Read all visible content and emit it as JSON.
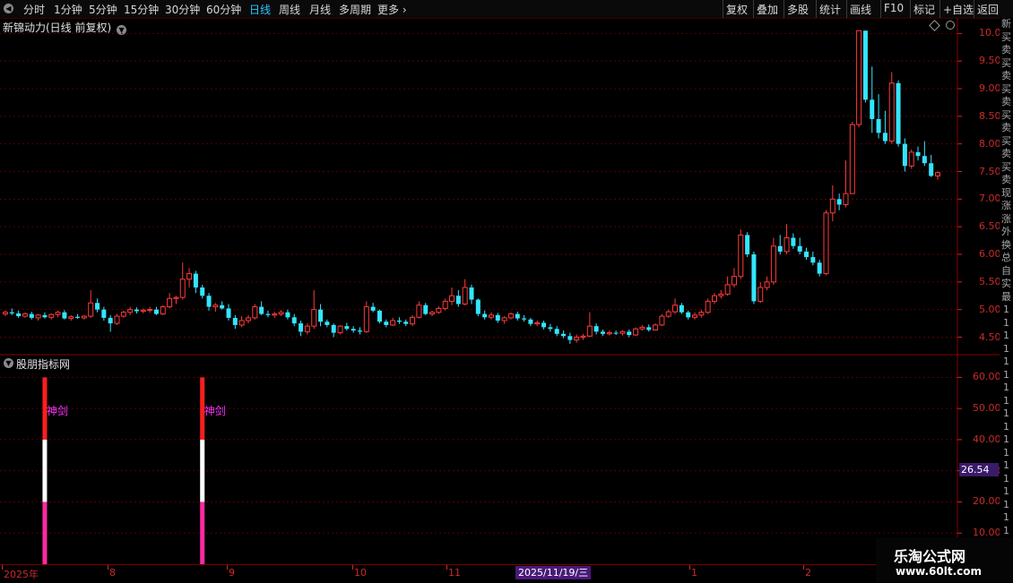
{
  "toolbar": {
    "left": [
      "分时",
      "1分钟",
      "5分钟",
      "15分钟",
      "30分钟",
      "60分钟",
      "日线",
      "周线",
      "月线",
      "多周期",
      "更多"
    ],
    "active": "日线",
    "more_arrow": "›",
    "right": [
      "复权",
      "叠加",
      "多股",
      "统计",
      "画线",
      "F10",
      "标记",
      "+自选",
      "返回"
    ]
  },
  "chart": {
    "title": "新锦动力(日线 前复权)",
    "y_ticks": [
      "10.00",
      "9.50",
      "9.00",
      "8.50",
      "8.00",
      "7.50",
      "7.00",
      "6.50",
      "6.00",
      "5.50",
      "5.00",
      "4.50"
    ]
  },
  "indicator": {
    "title": "股朋指标网",
    "y_ticks": [
      "60.00",
      "50.00",
      "40.00",
      "30.00",
      "20.00",
      "10.00"
    ],
    "current_value": "26.54",
    "signal_label": "神剑"
  },
  "date_axis": {
    "labels": [
      "2025年",
      "8",
      "9",
      "10",
      "11",
      "1",
      "2"
    ],
    "highlight": "2025/11/19/三"
  },
  "watermark": {
    "line1": "乐淘公式网",
    "line2": "www.60lt.com"
  },
  "right_strip": [
    "新",
    "买",
    "卖",
    "买",
    "卖",
    "买",
    "卖",
    "买",
    "卖",
    "买",
    "卖",
    "买",
    "卖",
    "现",
    "涨",
    "涨",
    "外",
    "换",
    "总",
    "自",
    "实",
    "最",
    "1",
    "1",
    "1",
    "1",
    "1",
    "1",
    "1",
    "1",
    "1",
    "1",
    "1",
    "1",
    "1",
    "1",
    "1",
    "1",
    "1",
    "1",
    "1",
    "1",
    "1"
  ],
  "colors": {
    "up": "#ff3a3a",
    "down": "#33e5ff",
    "grid": "#5a0000",
    "signal_red": "#ff1e1e",
    "signal_white": "#ffffff",
    "signal_pink": "#ff2aa0",
    "label": "#ff33ff"
  },
  "chart_data": {
    "type": "candlestick",
    "series": [
      {
        "o": 4.92,
        "h": 4.98,
        "l": 4.88,
        "c": 4.95
      },
      {
        "o": 4.95,
        "h": 5.02,
        "l": 4.9,
        "c": 4.93
      },
      {
        "o": 4.93,
        "h": 4.98,
        "l": 4.85,
        "c": 4.88
      },
      {
        "o": 4.88,
        "h": 4.95,
        "l": 4.85,
        "c": 4.92
      },
      {
        "o": 4.92,
        "h": 4.96,
        "l": 4.82,
        "c": 4.85
      },
      {
        "o": 4.85,
        "h": 4.92,
        "l": 4.8,
        "c": 4.9
      },
      {
        "o": 4.9,
        "h": 4.95,
        "l": 4.84,
        "c": 4.86
      },
      {
        "o": 4.86,
        "h": 4.93,
        "l": 4.82,
        "c": 4.91
      },
      {
        "o": 4.91,
        "h": 4.98,
        "l": 4.86,
        "c": 4.95
      },
      {
        "o": 4.95,
        "h": 4.99,
        "l": 4.82,
        "c": 4.84
      },
      {
        "o": 4.84,
        "h": 4.9,
        "l": 4.8,
        "c": 4.87
      },
      {
        "o": 4.87,
        "h": 4.92,
        "l": 4.83,
        "c": 4.85
      },
      {
        "o": 4.85,
        "h": 4.9,
        "l": 4.82,
        "c": 4.88
      },
      {
        "o": 4.88,
        "h": 5.35,
        "l": 4.85,
        "c": 5.12
      },
      {
        "o": 5.12,
        "h": 5.2,
        "l": 4.95,
        "c": 5.0
      },
      {
        "o": 5.0,
        "h": 5.05,
        "l": 4.8,
        "c": 4.85
      },
      {
        "o": 4.85,
        "h": 4.9,
        "l": 4.6,
        "c": 4.75
      },
      {
        "o": 4.75,
        "h": 4.92,
        "l": 4.72,
        "c": 4.88
      },
      {
        "o": 4.88,
        "h": 4.98,
        "l": 4.85,
        "c": 4.95
      },
      {
        "o": 4.95,
        "h": 5.05,
        "l": 4.9,
        "c": 5.0
      },
      {
        "o": 5.0,
        "h": 5.04,
        "l": 4.93,
        "c": 4.97
      },
      {
        "o": 4.97,
        "h": 5.02,
        "l": 4.93,
        "c": 4.99
      },
      {
        "o": 4.99,
        "h": 5.05,
        "l": 4.94,
        "c": 5.0
      },
      {
        "o": 5.0,
        "h": 5.05,
        "l": 4.9,
        "c": 4.92
      },
      {
        "o": 4.92,
        "h": 5.08,
        "l": 4.9,
        "c": 5.05
      },
      {
        "o": 5.05,
        "h": 5.3,
        "l": 5.02,
        "c": 5.2
      },
      {
        "o": 5.2,
        "h": 5.25,
        "l": 5.1,
        "c": 5.22
      },
      {
        "o": 5.22,
        "h": 5.85,
        "l": 5.18,
        "c": 5.55
      },
      {
        "o": 5.55,
        "h": 5.75,
        "l": 5.4,
        "c": 5.65
      },
      {
        "o": 5.65,
        "h": 5.7,
        "l": 5.3,
        "c": 5.4
      },
      {
        "o": 5.4,
        "h": 5.45,
        "l": 5.2,
        "c": 5.25
      },
      {
        "o": 5.25,
        "h": 5.3,
        "l": 4.98,
        "c": 5.05
      },
      {
        "o": 5.05,
        "h": 5.12,
        "l": 4.96,
        "c": 5.08
      },
      {
        "o": 5.08,
        "h": 5.15,
        "l": 5.0,
        "c": 5.02
      },
      {
        "o": 5.02,
        "h": 5.1,
        "l": 4.8,
        "c": 4.85
      },
      {
        "o": 4.85,
        "h": 4.9,
        "l": 4.65,
        "c": 4.72
      },
      {
        "o": 4.72,
        "h": 4.88,
        "l": 4.68,
        "c": 4.8
      },
      {
        "o": 4.8,
        "h": 4.9,
        "l": 4.75,
        "c": 4.85
      },
      {
        "o": 4.85,
        "h": 5.1,
        "l": 4.82,
        "c": 5.05
      },
      {
        "o": 5.05,
        "h": 5.15,
        "l": 4.9,
        "c": 4.92
      },
      {
        "o": 4.92,
        "h": 4.98,
        "l": 4.86,
        "c": 4.9
      },
      {
        "o": 4.9,
        "h": 4.96,
        "l": 4.85,
        "c": 4.92
      },
      {
        "o": 4.92,
        "h": 4.99,
        "l": 4.88,
        "c": 4.95
      },
      {
        "o": 4.95,
        "h": 5.0,
        "l": 4.82,
        "c": 4.86
      },
      {
        "o": 4.86,
        "h": 4.92,
        "l": 4.7,
        "c": 4.75
      },
      {
        "o": 4.75,
        "h": 4.8,
        "l": 4.52,
        "c": 4.6
      },
      {
        "o": 4.6,
        "h": 4.75,
        "l": 4.55,
        "c": 4.7
      },
      {
        "o": 4.7,
        "h": 5.35,
        "l": 4.65,
        "c": 5.0
      },
      {
        "o": 5.0,
        "h": 5.1,
        "l": 4.7,
        "c": 4.78
      },
      {
        "o": 4.78,
        "h": 4.82,
        "l": 4.68,
        "c": 4.72
      },
      {
        "o": 4.72,
        "h": 4.75,
        "l": 4.5,
        "c": 4.58
      },
      {
        "o": 4.58,
        "h": 4.72,
        "l": 4.55,
        "c": 4.7
      },
      {
        "o": 4.7,
        "h": 4.76,
        "l": 4.62,
        "c": 4.65
      },
      {
        "o": 4.65,
        "h": 4.7,
        "l": 4.58,
        "c": 4.62
      },
      {
        "o": 4.62,
        "h": 4.68,
        "l": 4.55,
        "c": 4.6
      },
      {
        "o": 4.6,
        "h": 5.15,
        "l": 4.58,
        "c": 5.05
      },
      {
        "o": 5.05,
        "h": 5.12,
        "l": 4.95,
        "c": 4.98
      },
      {
        "o": 4.98,
        "h": 5.0,
        "l": 4.75,
        "c": 4.78
      },
      {
        "o": 4.78,
        "h": 4.82,
        "l": 4.68,
        "c": 4.72
      },
      {
        "o": 4.72,
        "h": 4.85,
        "l": 4.7,
        "c": 4.8
      },
      {
        "o": 4.8,
        "h": 4.86,
        "l": 4.74,
        "c": 4.78
      },
      {
        "o": 4.78,
        "h": 4.82,
        "l": 4.7,
        "c": 4.74
      },
      {
        "o": 4.74,
        "h": 4.9,
        "l": 4.7,
        "c": 4.86
      },
      {
        "o": 4.86,
        "h": 5.15,
        "l": 4.84,
        "c": 5.08
      },
      {
        "o": 5.08,
        "h": 5.12,
        "l": 4.9,
        "c": 4.92
      },
      {
        "o": 4.92,
        "h": 4.98,
        "l": 4.88,
        "c": 4.95
      },
      {
        "o": 4.95,
        "h": 5.06,
        "l": 4.92,
        "c": 5.02
      },
      {
        "o": 5.02,
        "h": 5.2,
        "l": 4.98,
        "c": 5.15
      },
      {
        "o": 5.15,
        "h": 5.4,
        "l": 5.08,
        "c": 5.25
      },
      {
        "o": 5.25,
        "h": 5.35,
        "l": 5.05,
        "c": 5.1
      },
      {
        "o": 5.1,
        "h": 5.55,
        "l": 5.08,
        "c": 5.4
      },
      {
        "o": 5.4,
        "h": 5.45,
        "l": 5.1,
        "c": 5.18
      },
      {
        "o": 5.18,
        "h": 5.2,
        "l": 4.88,
        "c": 4.92
      },
      {
        "o": 4.92,
        "h": 4.98,
        "l": 4.82,
        "c": 4.86
      },
      {
        "o": 4.86,
        "h": 4.95,
        "l": 4.82,
        "c": 4.9
      },
      {
        "o": 4.9,
        "h": 4.94,
        "l": 4.76,
        "c": 4.8
      },
      {
        "o": 4.8,
        "h": 4.88,
        "l": 4.74,
        "c": 4.85
      },
      {
        "o": 4.85,
        "h": 4.95,
        "l": 4.82,
        "c": 4.92
      },
      {
        "o": 4.92,
        "h": 4.96,
        "l": 4.8,
        "c": 4.84
      },
      {
        "o": 4.84,
        "h": 4.9,
        "l": 4.78,
        "c": 4.82
      },
      {
        "o": 4.82,
        "h": 4.85,
        "l": 4.7,
        "c": 4.74
      },
      {
        "o": 4.74,
        "h": 4.8,
        "l": 4.7,
        "c": 4.76
      },
      {
        "o": 4.76,
        "h": 4.8,
        "l": 4.64,
        "c": 4.68
      },
      {
        "o": 4.68,
        "h": 4.74,
        "l": 4.6,
        "c": 4.65
      },
      {
        "o": 4.65,
        "h": 4.7,
        "l": 4.52,
        "c": 4.56
      },
      {
        "o": 4.56,
        "h": 4.62,
        "l": 4.48,
        "c": 4.52
      },
      {
        "o": 4.52,
        "h": 4.58,
        "l": 4.38,
        "c": 4.45
      },
      {
        "o": 4.45,
        "h": 4.55,
        "l": 4.4,
        "c": 4.5
      },
      {
        "o": 4.5,
        "h": 4.56,
        "l": 4.45,
        "c": 4.52
      },
      {
        "o": 4.52,
        "h": 4.95,
        "l": 4.5,
        "c": 4.7
      },
      {
        "o": 4.7,
        "h": 4.75,
        "l": 4.55,
        "c": 4.6
      },
      {
        "o": 4.6,
        "h": 4.64,
        "l": 4.52,
        "c": 4.56
      },
      {
        "o": 4.56,
        "h": 4.62,
        "l": 4.53,
        "c": 4.58
      },
      {
        "o": 4.58,
        "h": 4.62,
        "l": 4.54,
        "c": 4.57
      },
      {
        "o": 4.57,
        "h": 4.63,
        "l": 4.53,
        "c": 4.6
      },
      {
        "o": 4.6,
        "h": 4.64,
        "l": 4.5,
        "c": 4.54
      },
      {
        "o": 4.54,
        "h": 4.68,
        "l": 4.52,
        "c": 4.65
      },
      {
        "o": 4.65,
        "h": 4.72,
        "l": 4.62,
        "c": 4.68
      },
      {
        "o": 4.68,
        "h": 4.73,
        "l": 4.6,
        "c": 4.63
      },
      {
        "o": 4.63,
        "h": 4.75,
        "l": 4.62,
        "c": 4.72
      },
      {
        "o": 4.72,
        "h": 4.92,
        "l": 4.7,
        "c": 4.88
      },
      {
        "o": 4.88,
        "h": 5.0,
        "l": 4.85,
        "c": 4.96
      },
      {
        "o": 4.96,
        "h": 5.2,
        "l": 4.92,
        "c": 5.08
      },
      {
        "o": 5.08,
        "h": 5.12,
        "l": 4.92,
        "c": 4.95
      },
      {
        "o": 4.95,
        "h": 4.98,
        "l": 4.82,
        "c": 4.86
      },
      {
        "o": 4.86,
        "h": 4.95,
        "l": 4.82,
        "c": 4.9
      },
      {
        "o": 4.9,
        "h": 5.0,
        "l": 4.85,
        "c": 4.95
      },
      {
        "o": 4.95,
        "h": 5.2,
        "l": 4.92,
        "c": 5.15
      },
      {
        "o": 5.15,
        "h": 5.3,
        "l": 5.1,
        "c": 5.25
      },
      {
        "o": 5.25,
        "h": 5.35,
        "l": 5.2,
        "c": 5.28
      },
      {
        "o": 5.28,
        "h": 5.6,
        "l": 5.25,
        "c": 5.45
      },
      {
        "o": 5.45,
        "h": 5.75,
        "l": 5.4,
        "c": 5.6
      },
      {
        "o": 5.6,
        "h": 6.45,
        "l": 5.55,
        "c": 6.35
      },
      {
        "o": 6.35,
        "h": 6.4,
        "l": 5.95,
        "c": 6.0
      },
      {
        "o": 6.0,
        "h": 6.05,
        "l": 5.1,
        "c": 5.15
      },
      {
        "o": 5.15,
        "h": 5.5,
        "l": 5.12,
        "c": 5.4
      },
      {
        "o": 5.4,
        "h": 5.6,
        "l": 5.35,
        "c": 5.5
      },
      {
        "o": 5.5,
        "h": 6.3,
        "l": 5.45,
        "c": 6.15
      },
      {
        "o": 6.15,
        "h": 6.35,
        "l": 6.0,
        "c": 6.05
      },
      {
        "o": 6.05,
        "h": 6.55,
        "l": 6.0,
        "c": 6.3
      },
      {
        "o": 6.3,
        "h": 6.38,
        "l": 6.1,
        "c": 6.15
      },
      {
        "o": 6.15,
        "h": 6.3,
        "l": 6.0,
        "c": 6.05
      },
      {
        "o": 6.05,
        "h": 6.12,
        "l": 5.9,
        "c": 5.95
      },
      {
        "o": 5.95,
        "h": 6.05,
        "l": 5.8,
        "c": 5.85
      },
      {
        "o": 5.85,
        "h": 5.9,
        "l": 5.6,
        "c": 5.65
      },
      {
        "o": 5.65,
        "h": 6.8,
        "l": 5.62,
        "c": 6.75
      },
      {
        "o": 6.75,
        "h": 7.25,
        "l": 6.6,
        "c": 7.0
      },
      {
        "o": 7.0,
        "h": 7.1,
        "l": 6.8,
        "c": 6.9
      },
      {
        "o": 6.9,
        "h": 7.7,
        "l": 6.85,
        "c": 7.1
      },
      {
        "o": 7.1,
        "h": 8.4,
        "l": 7.5,
        "c": 8.35
      },
      {
        "o": 8.35,
        "h": 10.05,
        "l": 8.3,
        "c": 10.05
      },
      {
        "o": 10.05,
        "h": 10.05,
        "l": 8.75,
        "c": 8.8
      },
      {
        "o": 8.8,
        "h": 9.4,
        "l": 8.2,
        "c": 8.45
      },
      {
        "o": 8.45,
        "h": 8.9,
        "l": 8.1,
        "c": 8.2
      },
      {
        "o": 8.2,
        "h": 8.6,
        "l": 8.0,
        "c": 8.05
      },
      {
        "o": 8.05,
        "h": 9.3,
        "l": 8.0,
        "c": 9.1
      },
      {
        "o": 9.1,
        "h": 9.15,
        "l": 7.95,
        "c": 8.0
      },
      {
        "o": 8.0,
        "h": 8.1,
        "l": 7.5,
        "c": 7.6
      },
      {
        "o": 7.6,
        "h": 7.9,
        "l": 7.55,
        "c": 7.85
      },
      {
        "o": 7.85,
        "h": 7.95,
        "l": 7.7,
        "c": 7.78
      },
      {
        "o": 7.78,
        "h": 8.05,
        "l": 7.6,
        "c": 7.65
      },
      {
        "o": 7.65,
        "h": 7.8,
        "l": 7.4,
        "c": 7.42
      },
      {
        "o": 7.42,
        "h": 7.5,
        "l": 7.35,
        "c": 7.48
      }
    ],
    "ylim": [
      4.2,
      10.2
    ],
    "indicator_ylim": [
      0,
      65
    ],
    "signals": [
      {
        "bar_index": 6,
        "red": [
          40,
          60
        ],
        "white": [
          20,
          40
        ],
        "pink": [
          0,
          20
        ]
      },
      {
        "bar_index": 30,
        "red": [
          40,
          60
        ],
        "white": [
          20,
          40
        ],
        "pink": [
          0,
          20
        ]
      }
    ]
  }
}
